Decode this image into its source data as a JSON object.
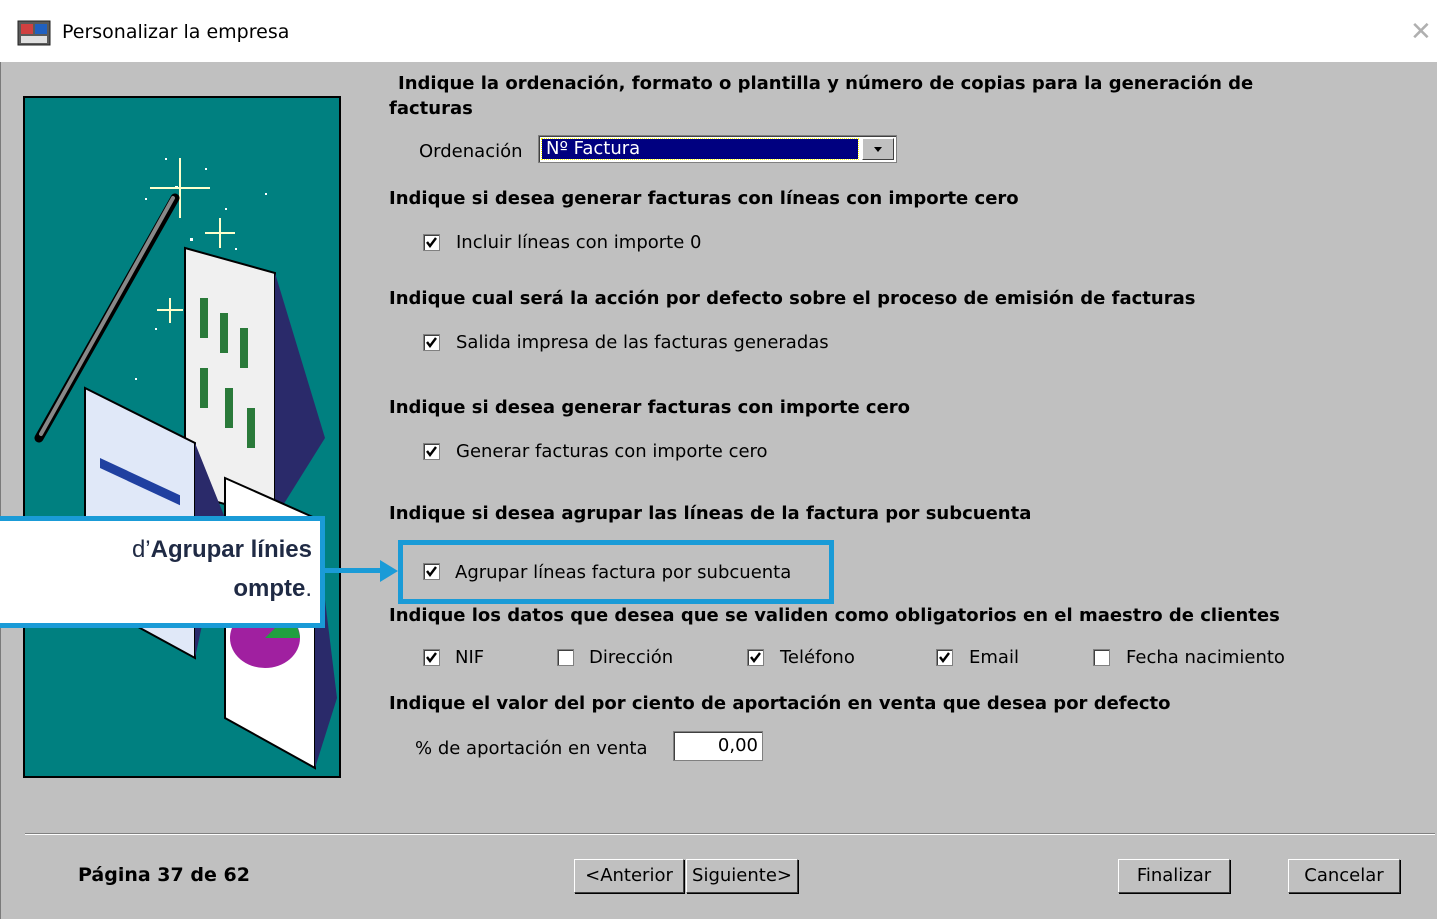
{
  "window": {
    "title": "Personalizar la empresa",
    "close_glyph": "✕"
  },
  "sections": {
    "ordering": {
      "heading_line1": "Indique la ordenación, formato o plantilla y número de copias para la generación de",
      "heading_line2": "facturas",
      "label": "Ordenación",
      "selected": "Nº Factura"
    },
    "zero_lines": {
      "heading": "Indique si desea generar facturas con líneas con importe cero",
      "option": "Incluir líneas con importe 0",
      "checked": true
    },
    "default_action": {
      "heading": "Indique cual será la acción por defecto sobre el proceso de emisión de facturas",
      "option": "Salida impresa de las facturas generadas",
      "checked": true
    },
    "zero_invoices": {
      "heading": "Indique si desea generar facturas con importe cero",
      "option": "Generar facturas con importe cero",
      "checked": true
    },
    "group_lines": {
      "heading": "Indique si desea agrupar las líneas de la factura por subcuenta",
      "option": "Agrupar líneas factura por subcuenta",
      "checked": true
    },
    "required_fields": {
      "heading": "Indique los datos que desea que se validen como obligatorios en el maestro de clientes",
      "options": [
        {
          "label": "NIF",
          "checked": true
        },
        {
          "label": "Dirección",
          "checked": false
        },
        {
          "label": "Teléfono",
          "checked": true
        },
        {
          "label": "Email",
          "checked": true
        },
        {
          "label": "Fecha nacimiento",
          "checked": false
        }
      ]
    },
    "contribution": {
      "heading": "Indique el valor del por ciento de aportación en venta que desea por defecto",
      "label": "% de aportación en venta",
      "value": "0,00"
    }
  },
  "footer": {
    "page": "Página 37 de 62",
    "prev": "<Anterior",
    "next": "Siguiente>",
    "finish": "Finalizar",
    "cancel": "Cancelar"
  },
  "callout": {
    "line1_prefix": "d’",
    "line1_bold": "Agrupar línies",
    "line2_bold": "ompte",
    "line2_suffix": "."
  },
  "colors": {
    "dialog_bg": "#c0c0c0",
    "illustration_bg": "#008080",
    "accent": "#1a9bd7",
    "selection": "#000080"
  }
}
